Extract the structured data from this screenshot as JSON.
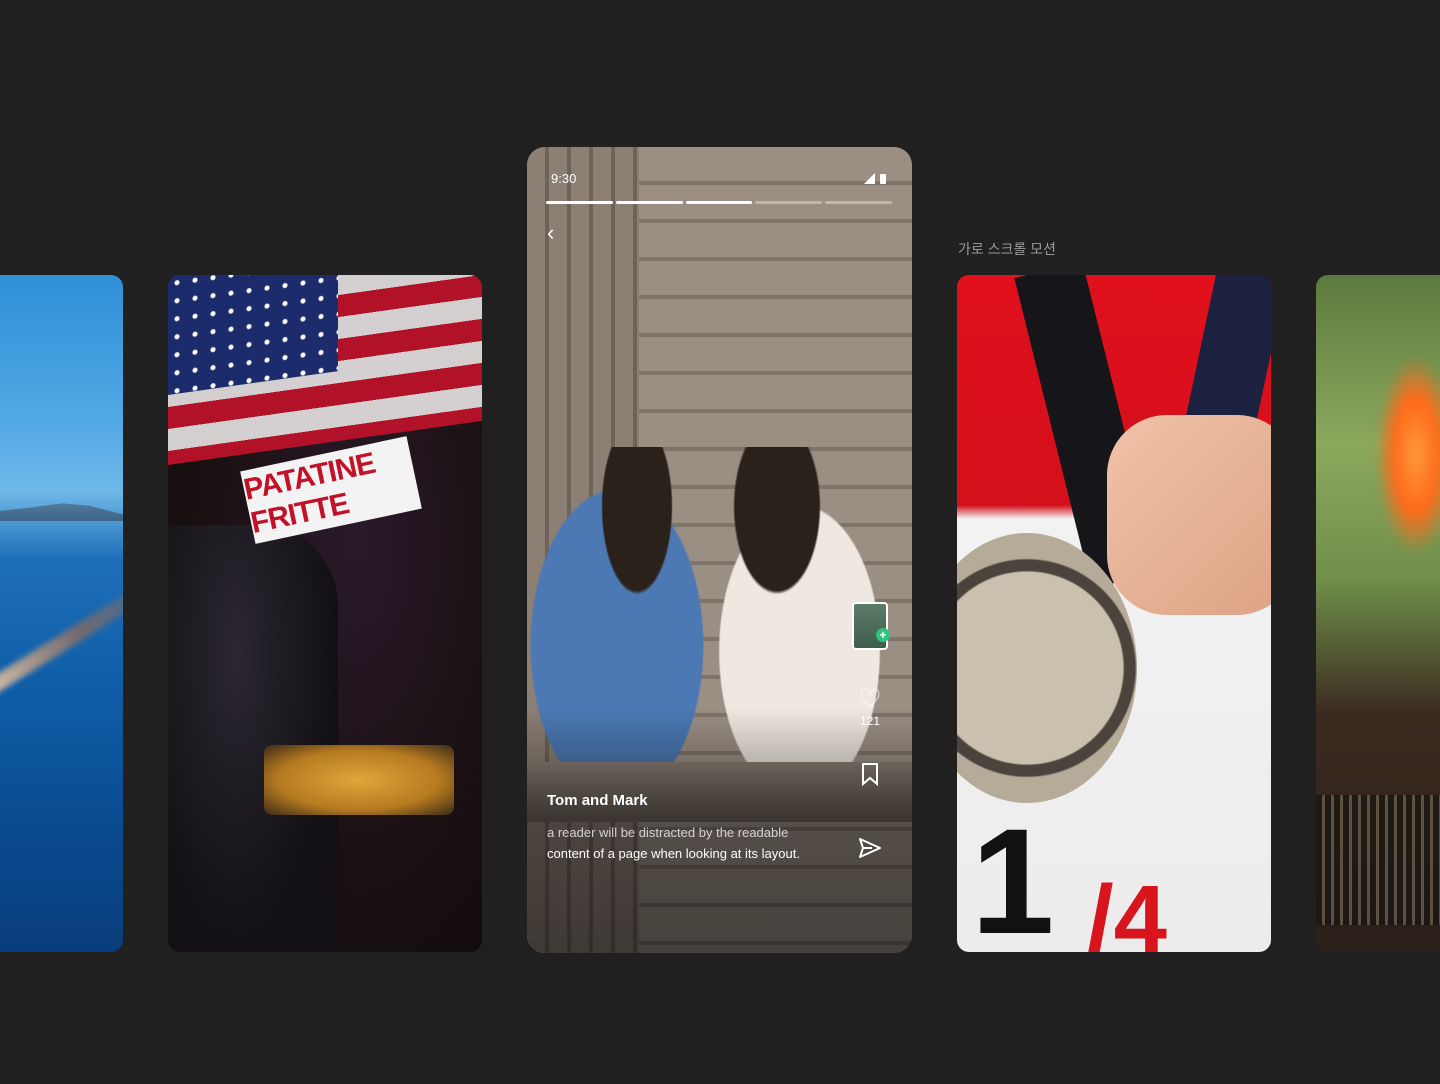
{
  "section_label": "가로 스크롤 모션",
  "phone": {
    "status_time": "9:30",
    "progress_segments": [
      1,
      1,
      1,
      0,
      0
    ],
    "title": "Tom and Mark",
    "caption_clipped": "a reader will be distracted by the readable",
    "caption": "content of a page when looking at its layout.",
    "like_count": "121",
    "icons": {
      "back": "chevron-left-icon",
      "add": "add-to-story-icon",
      "like": "heart-icon",
      "bookmark": "bookmark-icon",
      "send": "send-icon"
    }
  },
  "cards": {
    "stall_sign": "PATATINE FRITTE",
    "bib_number": "1",
    "bib_number2": "/4"
  },
  "colors": {
    "background": "#202020",
    "accent_green": "#2ec27e"
  }
}
